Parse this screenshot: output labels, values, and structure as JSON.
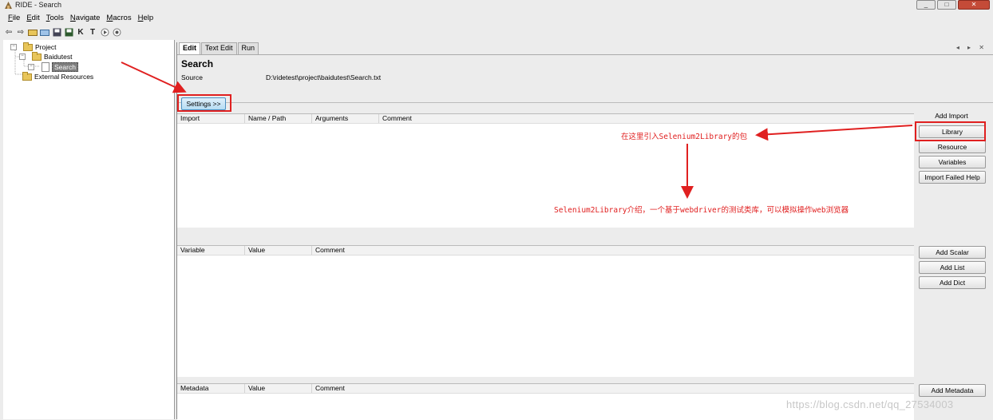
{
  "window": {
    "title": "RIDE - Search",
    "controls": [
      "_",
      "□",
      "✕"
    ]
  },
  "menubar": {
    "items": [
      {
        "underline": "F",
        "rest": "ile"
      },
      {
        "underline": "E",
        "rest": "dit"
      },
      {
        "underline": "T",
        "rest": "ools"
      },
      {
        "underline": "N",
        "rest": "avigate"
      },
      {
        "underline": "M",
        "rest": "acros"
      },
      {
        "underline": "H",
        "rest": "elp"
      }
    ]
  },
  "toolbar": {
    "icons": [
      "back-icon",
      "forward-icon",
      "open-folder-icon",
      "open-directory-icon",
      "save-icon",
      "save-all-icon",
      "keyword-search-icon",
      "test-search-icon",
      "run-icon",
      "stop-icon"
    ]
  },
  "tree": {
    "project": "Project",
    "suite": "Baidutest",
    "testfile": "Search",
    "external": "External Resources"
  },
  "editor": {
    "tabs": [
      "Edit",
      "Text Edit",
      "Run"
    ],
    "tab_controls": "◂ ▸ ✕",
    "heading": "Search",
    "source_label": "Source",
    "source_value": "D:\\ridetest\\project\\baidutest\\Search.txt",
    "settings_button": "Settings >>",
    "import_table": {
      "columns": [
        "Import",
        "Name / Path",
        "Arguments",
        "Comment"
      ]
    },
    "variable_table": {
      "columns": [
        "Variable",
        "Value",
        "Comment"
      ]
    },
    "metadata_table": {
      "columns": [
        "Metadata",
        "Value",
        "Comment"
      ]
    },
    "add_import_label": "Add Import",
    "import_buttons": [
      "Library",
      "Resource",
      "Variables",
      "Import Failed Help"
    ],
    "variable_buttons": [
      "Add Scalar",
      "Add List",
      "Add Dict"
    ],
    "metadata_button": "Add Metadata"
  },
  "annotations": {
    "library_note": "在这里引入Selenium2Library的包",
    "selenium_note": "Selenium2Library介绍，一个基于webdriver的测试类库，可以模拟操作web浏览器",
    "color": "#e02020"
  },
  "watermark": "https://blog.csdn.net/qq_27534003"
}
